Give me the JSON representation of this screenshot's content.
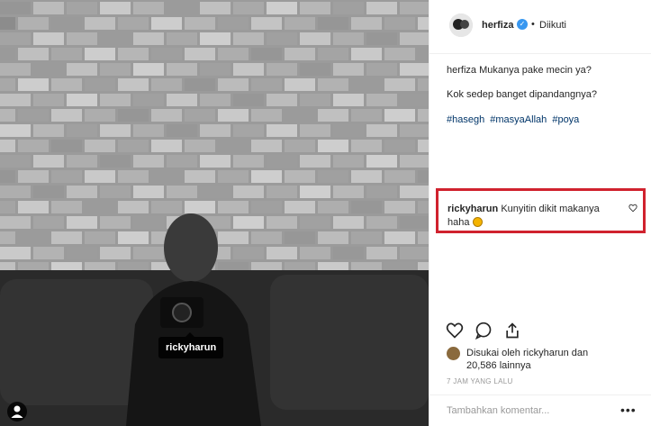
{
  "photo": {
    "tag_username": "rickyharun"
  },
  "post": {
    "username": "herfiza",
    "follow_separator": "•",
    "follow_status": "Diikuti",
    "caption_lines": [
      "herfiza Mukanya pake mecin ya?",
      "Kok sedep banget dipandangnya?"
    ],
    "hashtags": [
      "#hasegh",
      "#masyaAllah",
      "#poya"
    ],
    "highlighted_comment": {
      "username": "rickyharun",
      "text": "Kunyitin dikit makanya haha",
      "highlight_color": "#d0222e"
    },
    "likes_text": "Disukai oleh rickyharun dan 20,586 lainnya",
    "timestamp": "7 JAM YANG LALU",
    "comment_placeholder": "Tambahkan komentar...",
    "more_icon": "•••"
  },
  "icons": {
    "verified": "verified-badge-icon",
    "heart": "heart-icon",
    "comment": "comment-icon",
    "share": "share-icon",
    "person": "person-tag-icon"
  }
}
